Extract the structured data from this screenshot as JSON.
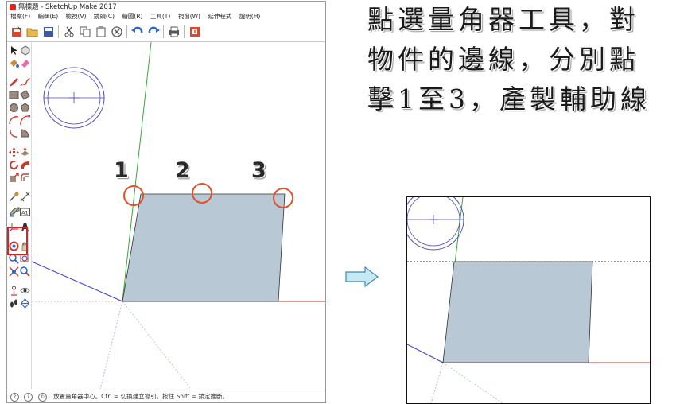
{
  "window": {
    "title": "無標題 - SketchUp Make 2017",
    "menu": [
      "檔案(F)",
      "編輯(E)",
      "檢視(V)",
      "鏡頭(C)",
      "繪圖(R)",
      "工具(T)",
      "視窗(W)",
      "延伸程式",
      "說明(H)"
    ]
  },
  "toolbar": {
    "icons": [
      "getting-started-icon",
      "open-icon",
      "save-icon",
      "cut-icon",
      "copy-icon",
      "paste-icon",
      "erase-icon",
      "undo-icon",
      "redo-icon",
      "print-icon",
      "model-info-icon"
    ]
  },
  "left_toolbar": {
    "selected_tool": "protractor-tool",
    "text_tool_label": "A1"
  },
  "canvas": {
    "steps": [
      "1",
      "2",
      "3"
    ],
    "colors": {
      "face": "#b8c8d4",
      "marker": "#e3502a",
      "red_axis": "#d03030",
      "green_axis": "#3aa63a",
      "blue_axis": "#3b3bd0"
    }
  },
  "status": {
    "icons": [
      "geo-location-icon",
      "info-icon",
      "credits-icon"
    ],
    "text": "放置量角器中心。Ctrl = 切換建立導引。按住 Shift = 鎖定推斷。"
  },
  "instruction": {
    "lines": [
      "點選量角器工具，對",
      "物件的邊線，分別點",
      "擊1至3，產製輔助線"
    ]
  }
}
